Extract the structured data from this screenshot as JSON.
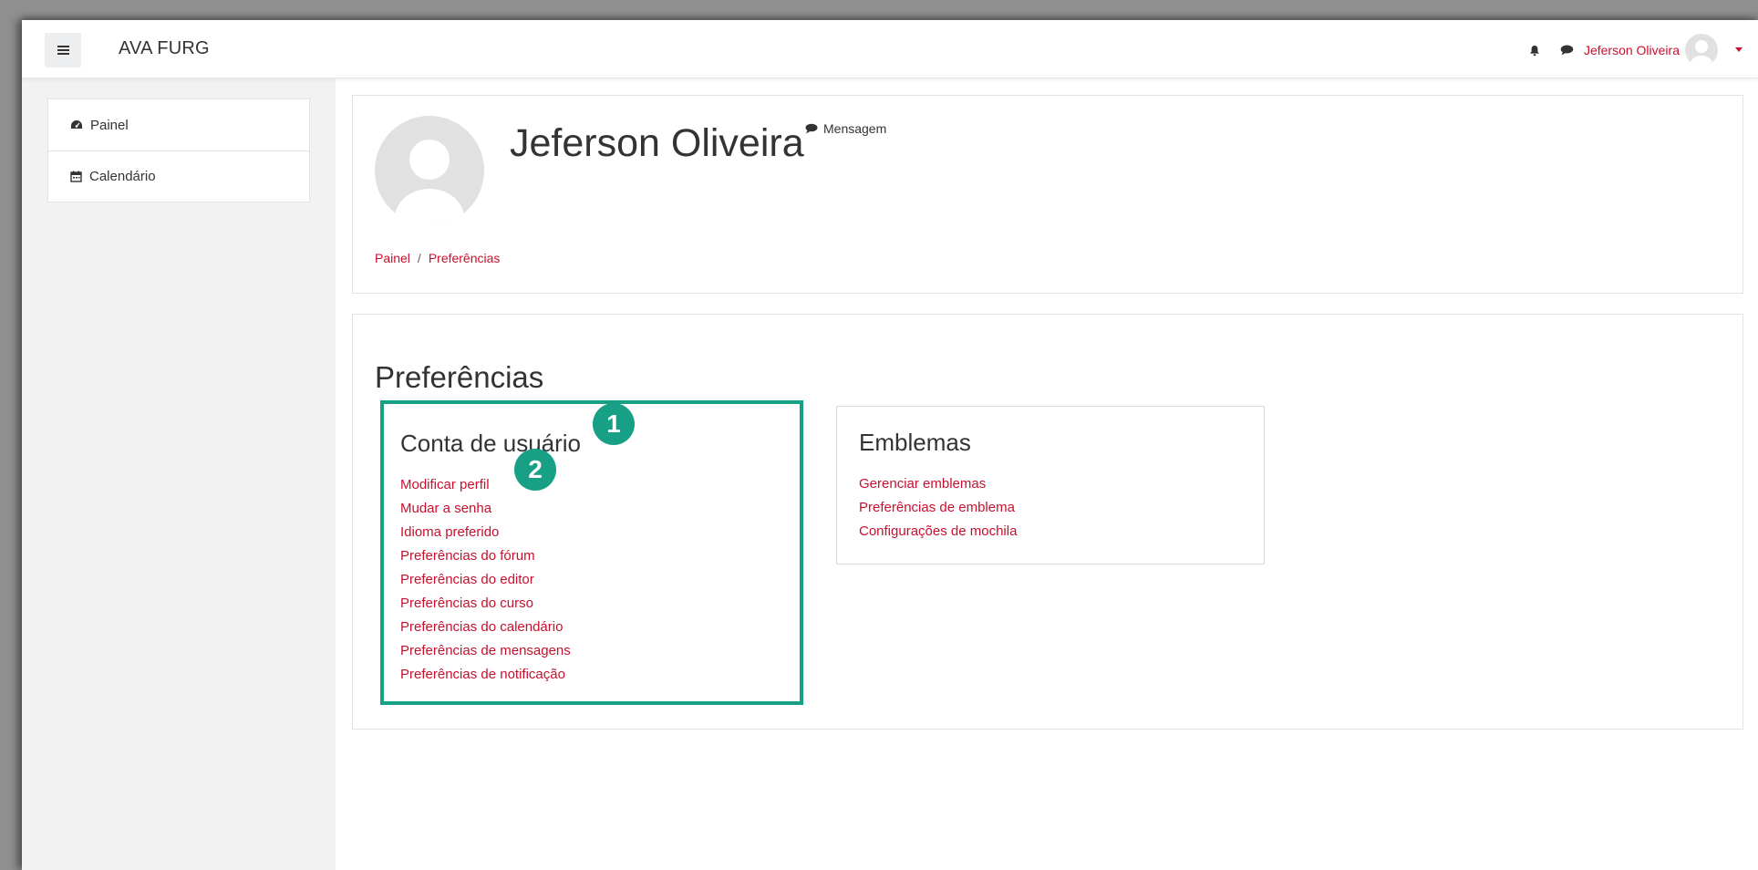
{
  "navbar": {
    "brand": "AVA FURG",
    "user_name": "Jeferson Oliveira",
    "icons": [
      "bell-icon",
      "chat-icon",
      "avatar",
      "caret-down-icon"
    ]
  },
  "sidebar": {
    "items": [
      {
        "label": "Painel",
        "icon": "dashboard-icon"
      },
      {
        "label": "Calendário",
        "icon": "calendar-icon"
      }
    ]
  },
  "header": {
    "name": "Jeferson Oliveira",
    "message_label": "Mensagem",
    "breadcrumb": [
      "Painel",
      "Preferências"
    ],
    "breadcrumb_sep": "/"
  },
  "preferences": {
    "title": "Preferências",
    "sections": [
      {
        "title": "Conta de usuário",
        "links": [
          "Modificar perfil",
          "Mudar a senha",
          "Idioma preferido",
          "Preferências do fórum",
          "Preferências do editor",
          "Preferências do curso",
          "Preferências do calendário",
          "Preferências de mensagens",
          "Preferências de notificação"
        ]
      },
      {
        "title": "Emblemas",
        "links": [
          "Gerenciar emblemas",
          "Preferências de emblema",
          "Configurações de mochila"
        ]
      }
    ]
  },
  "annotations": [
    "1",
    "2"
  ],
  "colors": {
    "link": "#c8102e",
    "highlight": "#17a085",
    "sidebar_bg": "#f2f2f2"
  }
}
